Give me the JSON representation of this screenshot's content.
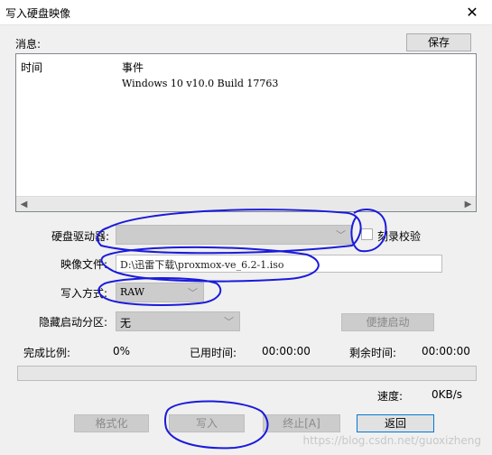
{
  "window": {
    "title": "写入硬盘映像",
    "close_glyph": "✕"
  },
  "messages": {
    "label": "消息:",
    "save_label": "保存",
    "columns": {
      "time": "时间",
      "event": "事件"
    },
    "rows": [
      {
        "time": "",
        "event": "Windows 10 v10.0 Build 17763"
      }
    ]
  },
  "disk_drive": {
    "label": "硬盘驱动器:",
    "value": "",
    "verify_label": "刻录校验",
    "verify_checked": false
  },
  "image_file": {
    "label": "映像文件:",
    "value": "D:\\迅雷下载\\proxmox-ve_6.2-1.iso"
  },
  "write_method": {
    "label": "写入方式:",
    "value": "RAW"
  },
  "hidden_partition": {
    "label": "隐藏启动分区:",
    "value": "无",
    "quick_boot_label": "便捷启动"
  },
  "progress": {
    "percent_label": "完成比例:",
    "percent_value": "0%",
    "elapsed_label": "已用时间:",
    "elapsed_value": "00:00:00",
    "remaining_label": "剩余时间:",
    "remaining_value": "00:00:00",
    "speed_label": "速度:",
    "speed_value": "0KB/s",
    "fraction": 0
  },
  "buttons": {
    "format": "格式化",
    "write": "写入",
    "abort": "终止[A]",
    "back": "返回"
  },
  "watermark": "https://blog.csdn.net/guoxizheng",
  "annotation_color": "#1a1adc"
}
